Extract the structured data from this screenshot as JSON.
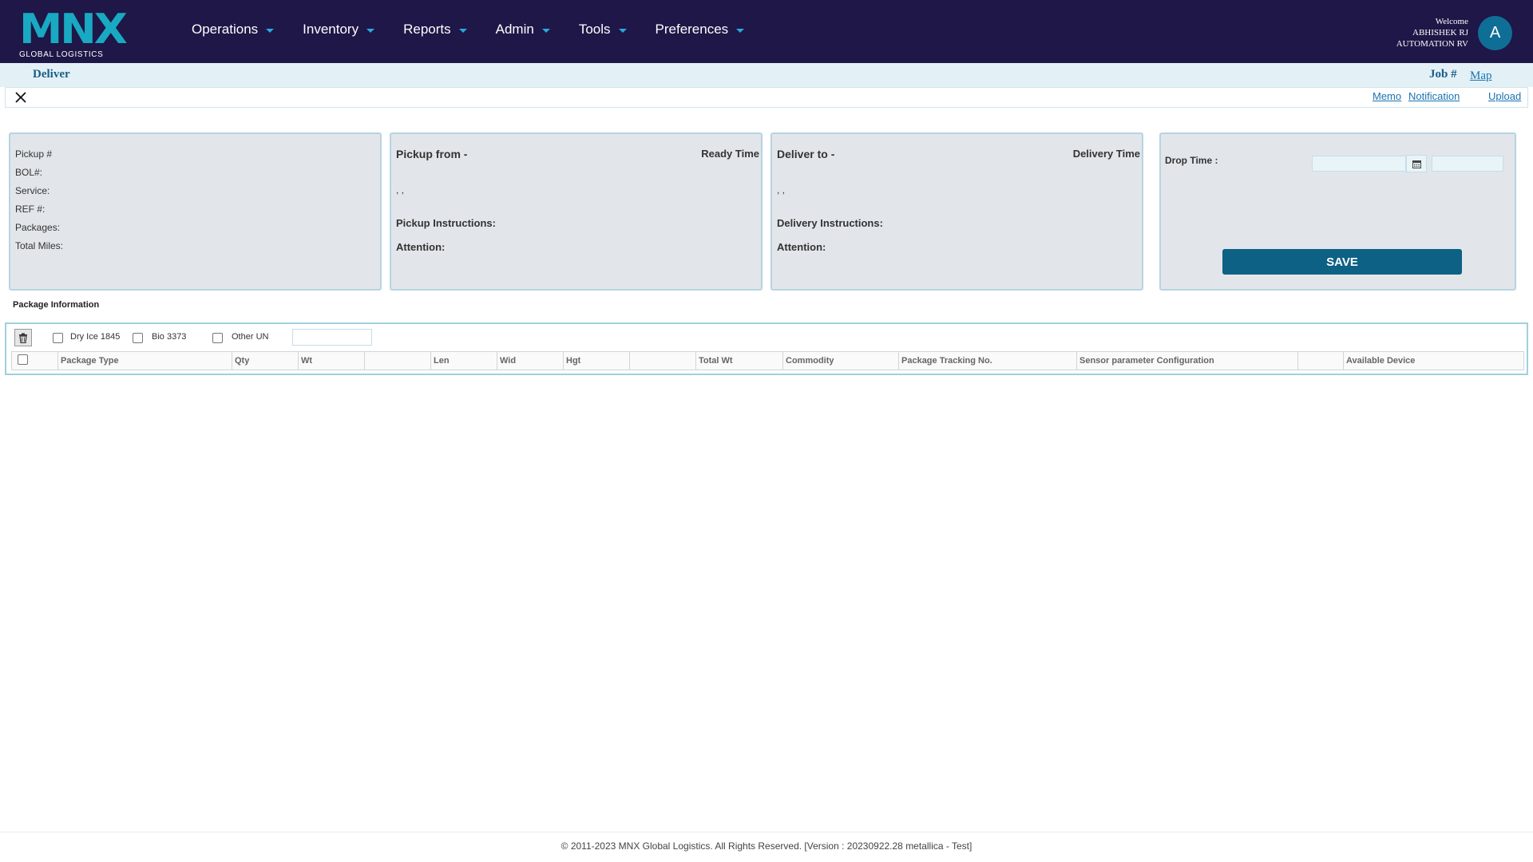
{
  "brand": {
    "logo_text": "MNX",
    "tagline": "GLOBAL LOGISTICS",
    "accent_color": "#19a9c2",
    "nav_bg": "#1e1747"
  },
  "nav": {
    "items": [
      {
        "label": "Operations"
      },
      {
        "label": "Inventory"
      },
      {
        "label": "Reports"
      },
      {
        "label": "Admin"
      },
      {
        "label": "Tools"
      },
      {
        "label": "Preferences"
      }
    ]
  },
  "user": {
    "welcome": "Welcome",
    "name": "ABHISHEK RJ",
    "company": "AUTOMATION RV",
    "avatar_initial": "A"
  },
  "page": {
    "title": "Deliver",
    "job_label": "Job #",
    "map_link": "Map",
    "links": {
      "memo": "Memo",
      "notification": "Notification",
      "upload": "Upload"
    }
  },
  "job_info": {
    "pickup_no": "Pickup #",
    "bol": "BOL#:",
    "service": "Service:",
    "ref": "REF #:",
    "packages": "Packages:",
    "total_miles": "Total Miles:"
  },
  "pickup": {
    "heading": "Pickup from -",
    "time_label": "Ready Time",
    "address": ", ,",
    "instructions": "Pickup Instructions:",
    "attention": "Attention:"
  },
  "delivery": {
    "heading": "Deliver to -",
    "time_label": "Delivery Time",
    "address": ", ,",
    "instructions": "Delivery Instructions:",
    "attention": "Attention:"
  },
  "drop": {
    "label": "Drop Time :",
    "date_value": "",
    "time_value": "",
    "save_label": "SAVE",
    "save_color": "#0c6184"
  },
  "package": {
    "title": "Package Information",
    "options": [
      {
        "label": "Dry Ice 1845",
        "checked": false
      },
      {
        "label": "Bio 3373",
        "checked": false
      },
      {
        "label": "Other UN",
        "checked": false
      }
    ],
    "other_un_value": "",
    "columns": [
      "",
      "Package Type",
      "Qty",
      "Wt",
      "",
      "Len",
      "Wid",
      "Hgt",
      "",
      "Total Wt",
      "Commodity",
      "Package Tracking No.",
      "Sensor parameter Configuration",
      "",
      "Available Device"
    ]
  },
  "footer": {
    "text": "© 2011-2023 MNX Global Logistics. All Rights Reserved. [Version : 20230922.28 metallica - Test]"
  }
}
